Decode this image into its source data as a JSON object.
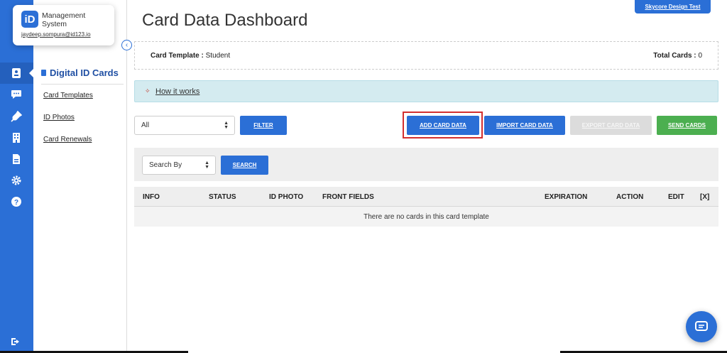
{
  "brand": {
    "badge": "iD",
    "line1": "Management",
    "line2": "System",
    "email": "jaydeep.sompura@id123.io"
  },
  "rail_icons": [
    "id-card-icon",
    "chat-icon",
    "plug-icon",
    "building-icon",
    "document-icon",
    "gear-icon",
    "help-icon",
    "logout-icon"
  ],
  "sidebar": {
    "title": "Digital ID Cards",
    "links": [
      "Card Templates",
      "ID Photos",
      "Card Renewals"
    ]
  },
  "header": {
    "title": "Card Data Dashboard",
    "skycore_label": "Skycore Design Test"
  },
  "template_info": {
    "template_label": "Card Template :",
    "template_value": "Student",
    "total_label": "Total Cards :",
    "total_value": "0"
  },
  "howto": {
    "label": "How it works"
  },
  "filter": {
    "select_value": "All",
    "filter_button": "FILTER"
  },
  "actions": {
    "add": "ADD CARD DATA",
    "import": "IMPORT CARD DATA",
    "export": "EXPORT CARD DATA",
    "send": "SEND CARDS"
  },
  "search": {
    "select_value": "Search By",
    "search_button": "SEARCH"
  },
  "table": {
    "columns": [
      "INFO",
      "STATUS",
      "ID PHOTO",
      "FRONT FIELDS",
      "EXPIRATION",
      "ACTION",
      "EDIT",
      "[X]"
    ],
    "empty_message": "There are no cards in this card template"
  },
  "colors": {
    "primary": "#2b6fd6",
    "success": "#4caf50",
    "disabled": "#dcdcdc",
    "highlight": "#d32f2f",
    "info_bg": "#d4ebf0"
  }
}
